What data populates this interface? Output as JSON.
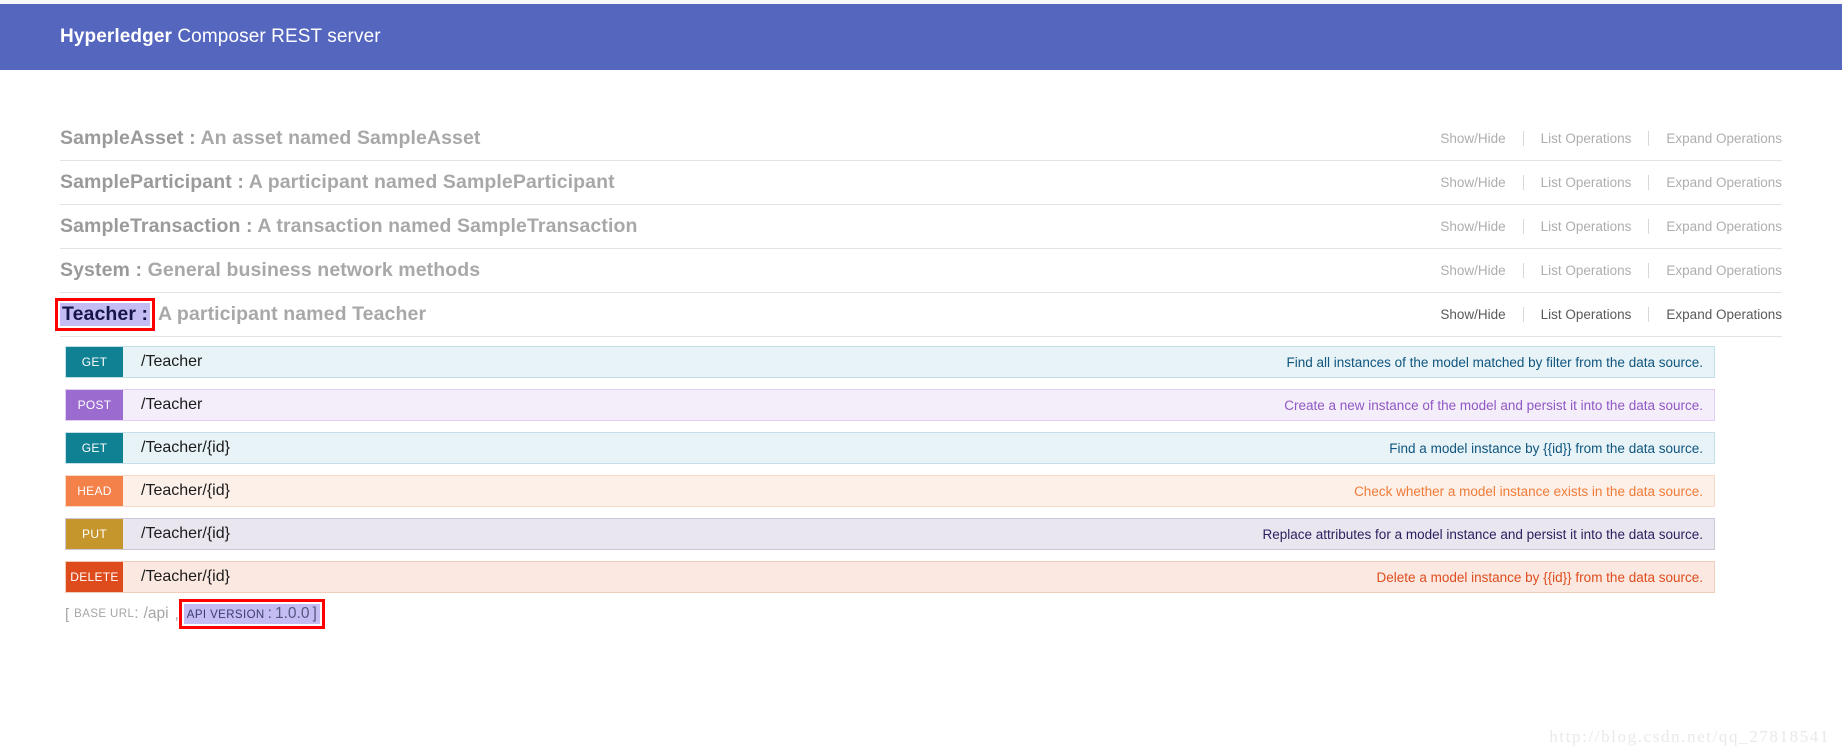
{
  "header": {
    "brand": "Hyperledger",
    "suffix": " Composer REST server",
    "background_color": "#5566bf"
  },
  "operation_links": {
    "show_hide": "Show/Hide",
    "list_operations": "List Operations",
    "expand_operations": "Expand Operations"
  },
  "resources": [
    {
      "name": "SampleAsset",
      "separator": " : ",
      "description": "An asset named SampleAsset",
      "expanded": false,
      "selected": false
    },
    {
      "name": "SampleParticipant",
      "separator": " : ",
      "description": "A participant named SampleParticipant",
      "expanded": false,
      "selected": false
    },
    {
      "name": "SampleTransaction",
      "separator": " : ",
      "description": "A transaction named SampleTransaction",
      "expanded": false,
      "selected": false
    },
    {
      "name": "System",
      "separator": " : ",
      "description": "General business network methods",
      "expanded": false,
      "selected": false
    },
    {
      "name": "Teacher :",
      "separator": " ",
      "description": "A participant named Teacher",
      "expanded": true,
      "selected": true
    }
  ],
  "endpoints": [
    {
      "verb": "GET",
      "path": "/Teacher",
      "description": "Find all instances of the model matched by filter from the data source.",
      "theme": "get",
      "verb_color": "#0f8193",
      "row_color": "#e7f3f7"
    },
    {
      "verb": "POST",
      "path": "/Teacher",
      "description": "Create a new instance of the model and persist it into the data source.",
      "theme": "post",
      "verb_color": "#9b6bd0",
      "row_color": "#f4edfa"
    },
    {
      "verb": "GET",
      "path": "/Teacher/{id}",
      "description": "Find a model instance by {{id}} from the data source.",
      "theme": "get",
      "verb_color": "#0f8193",
      "row_color": "#e7f3f7"
    },
    {
      "verb": "HEAD",
      "path": "/Teacher/{id}",
      "description": "Check whether a model instance exists in the data source.",
      "theme": "head",
      "verb_color": "#f4804a",
      "row_color": "#fdf0e9"
    },
    {
      "verb": "PUT",
      "path": "/Teacher/{id}",
      "description": "Replace attributes for a model instance and persist it into the data source.",
      "theme": "put",
      "verb_color": "#c5962c",
      "row_color": "#e9e6ef"
    },
    {
      "verb": "DELETE",
      "path": "/Teacher/{id}",
      "description": "Delete a model instance by {{id}} from the data source.",
      "theme": "delete",
      "verb_color": "#de4c1e",
      "row_color": "#fbe9e1"
    }
  ],
  "footer": {
    "open_bracket": "[",
    "base_url_label": "BASE URL",
    "base_url_colon": ":",
    "base_url_value": "/api",
    "comma": ",",
    "api_version_label": "API VERSION",
    "api_version_colon": ":",
    "api_version_value": "1.0.0",
    "close_bracket": "]"
  },
  "watermark": {
    "text": "http://blog.csdn.net/qq_27818541"
  },
  "annotation": {
    "box_color": "#ff0000",
    "selection_color": "#c3bdf4"
  }
}
